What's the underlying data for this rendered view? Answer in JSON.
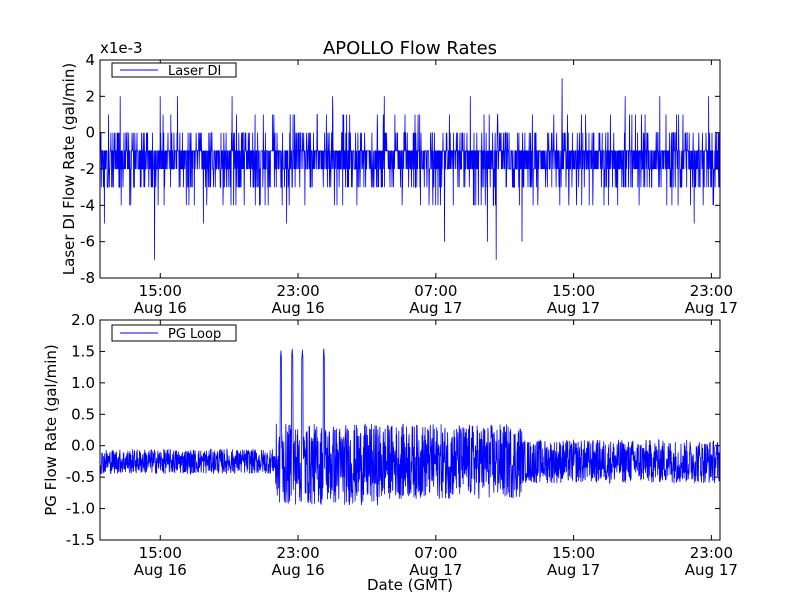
{
  "figure": {
    "title": "APOLLO Flow Rates",
    "xlabel": "Date (GMT)"
  },
  "chart_data": [
    {
      "type": "line",
      "ylabel": "Laser DI Flow Rate (gal/min)",
      "y_multiplier": "x1e-3",
      "ylim": [
        -8,
        4
      ],
      "yticks": [
        -8,
        -6,
        -4,
        -2,
        0,
        2,
        4
      ],
      "ytick_labels": [
        "-8",
        "-6",
        "-4",
        "-2",
        "0",
        "2",
        "4"
      ],
      "xticks": [
        {
          "time": "15:00",
          "date": "Aug 16"
        },
        {
          "time": "23:00",
          "date": "Aug 16"
        },
        {
          "time": "07:00",
          "date": "Aug 17"
        },
        {
          "time": "15:00",
          "date": "Aug 17"
        },
        {
          "time": "23:00",
          "date": "Aug 17"
        }
      ],
      "xlim": [
        "2013-08-16 11:30",
        "2013-08-17 23:30"
      ],
      "legend": {
        "placement": "top-left"
      },
      "grid": false,
      "series": [
        {
          "name": "Laser DI",
          "color": "#0000ff",
          "baseline": -1.5,
          "quantization": 1,
          "typical_range": [
            -3,
            0
          ],
          "spikes": [
            {
              "time": "2013-08-16 11:45",
              "value": -5
            },
            {
              "time": "2013-08-16 12:00",
              "value": 1
            },
            {
              "time": "2013-08-16 12:40",
              "value": 2
            },
            {
              "time": "2013-08-16 14:40",
              "value": -7
            },
            {
              "time": "2013-08-16 15:00",
              "value": 2
            },
            {
              "time": "2013-08-16 16:00",
              "value": 2
            },
            {
              "time": "2013-08-16 17:30",
              "value": -5
            },
            {
              "time": "2013-08-16 19:10",
              "value": 2
            },
            {
              "time": "2013-08-16 22:20",
              "value": -5
            },
            {
              "time": "2013-08-17 01:00",
              "value": 2
            },
            {
              "time": "2013-08-17 04:00",
              "value": 2
            },
            {
              "time": "2013-08-17 07:30",
              "value": -6
            },
            {
              "time": "2013-08-17 09:00",
              "value": 2
            },
            {
              "time": "2013-08-17 10:00",
              "value": -6
            },
            {
              "time": "2013-08-17 10:30",
              "value": -7
            },
            {
              "time": "2013-08-17 12:00",
              "value": -6
            },
            {
              "time": "2013-08-17 14:20",
              "value": 3
            },
            {
              "time": "2013-08-17 18:00",
              "value": 2
            },
            {
              "time": "2013-08-17 20:00",
              "value": 2
            },
            {
              "time": "2013-08-17 22:00",
              "value": -5
            },
            {
              "time": "2013-08-17 22:50",
              "value": 2
            }
          ]
        }
      ]
    },
    {
      "type": "line",
      "ylabel": "PG Flow Rate (gal/min)",
      "ylim": [
        -1.5,
        2.0
      ],
      "yticks": [
        -1.5,
        -1.0,
        -0.5,
        0.0,
        0.5,
        1.0,
        1.5,
        2.0
      ],
      "ytick_labels": [
        "-1.5",
        "-1.0",
        "-0.5",
        "0.0",
        "0.5",
        "1.0",
        "1.5",
        "2.0"
      ],
      "xticks": [
        {
          "time": "15:00",
          "date": "Aug 16"
        },
        {
          "time": "23:00",
          "date": "Aug 16"
        },
        {
          "time": "07:00",
          "date": "Aug 17"
        },
        {
          "time": "15:00",
          "date": "Aug 17"
        },
        {
          "time": "23:00",
          "date": "Aug 17"
        }
      ],
      "xlim": [
        "2013-08-16 11:30",
        "2013-08-17 23:30"
      ],
      "legend": {
        "placement": "top-left"
      },
      "grid": false,
      "series": [
        {
          "name": "PG Loop",
          "color": "#0000ff",
          "segments": [
            {
              "start": "2013-08-16 11:30",
              "end": "2013-08-16 21:40",
              "center": -0.25,
              "amplitude": 0.2
            },
            {
              "start": "2013-08-16 21:40",
              "end": "2013-08-17 04:00",
              "center": -0.3,
              "amplitude": 0.65
            },
            {
              "start": "2013-08-17 04:00",
              "end": "2013-08-17 12:00",
              "center": -0.25,
              "amplitude": 0.6
            },
            {
              "start": "2013-08-17 12:00",
              "end": "2013-08-17 23:30",
              "center": -0.25,
              "amplitude": 0.35
            }
          ],
          "peaks": [
            {
              "time": "2013-08-16 22:00",
              "value": 1.55
            },
            {
              "time": "2013-08-16 22:40",
              "value": 1.55
            },
            {
              "time": "2013-08-16 23:15",
              "value": 1.55
            },
            {
              "time": "2013-08-17 00:30",
              "value": 1.55
            }
          ],
          "min_value": -1.05
        }
      ]
    }
  ]
}
